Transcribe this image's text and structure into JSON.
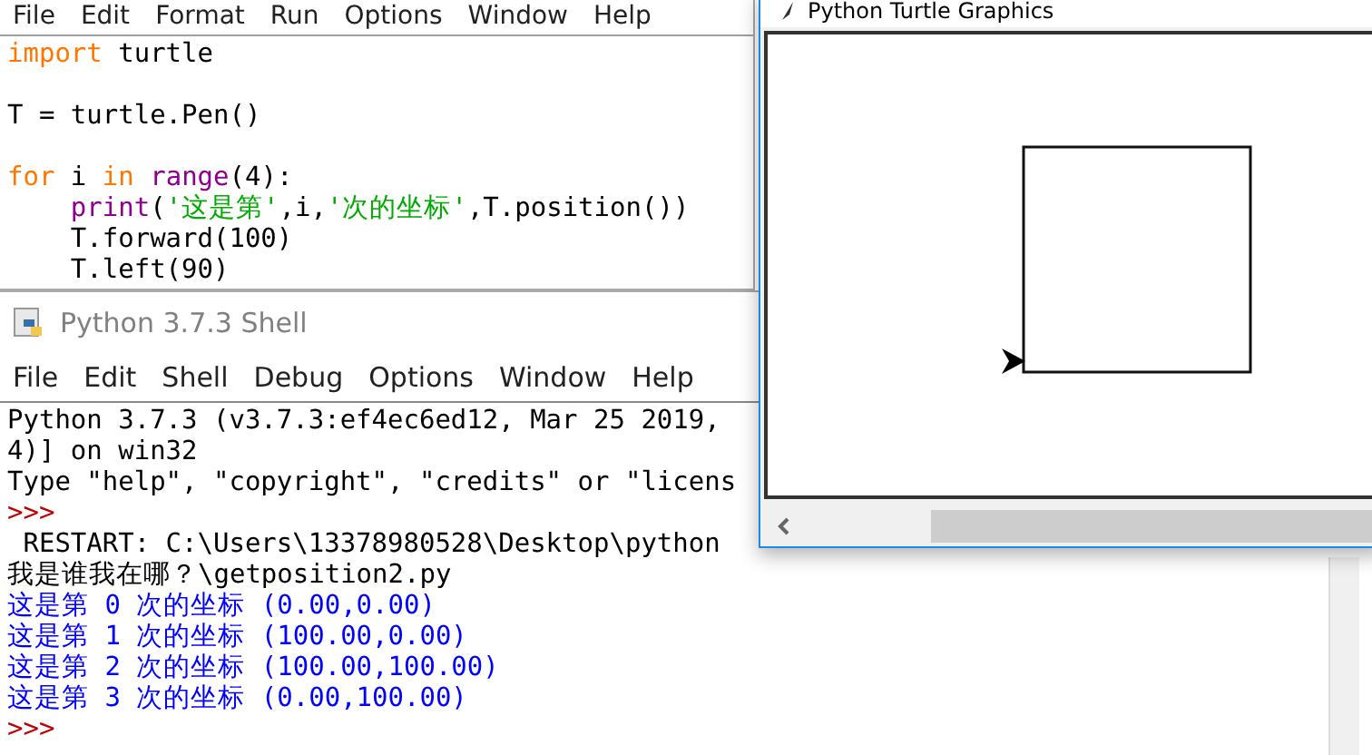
{
  "editor": {
    "menu": [
      "File",
      "Edit",
      "Format",
      "Run",
      "Options",
      "Window",
      "Help"
    ],
    "lines": [
      {
        "kind": "code",
        "tokens": [
          {
            "kind": "keyword",
            "text": "import"
          },
          {
            "kind": "plain",
            "text": " turtle"
          }
        ]
      },
      {
        "kind": "blank"
      },
      {
        "kind": "code",
        "tokens": [
          {
            "kind": "plain",
            "text": "T = turtle.Pen()"
          }
        ]
      },
      {
        "kind": "blank"
      },
      {
        "kind": "code",
        "tokens": [
          {
            "kind": "keyword",
            "text": "for"
          },
          {
            "kind": "plain",
            "text": " i "
          },
          {
            "kind": "keyword",
            "text": "in"
          },
          {
            "kind": "builtin",
            "text": " range"
          },
          {
            "kind": "plain",
            "text": "(4):"
          }
        ]
      },
      {
        "kind": "code",
        "tokens": [
          {
            "kind": "builtin",
            "text": "    print"
          },
          {
            "kind": "plain",
            "text": "("
          },
          {
            "kind": "string",
            "text": "'这是第'"
          },
          {
            "kind": "plain",
            "text": ",i,"
          },
          {
            "kind": "string",
            "text": "'次的坐标'"
          },
          {
            "kind": "plain",
            "text": ",T.position())"
          }
        ]
      },
      {
        "kind": "code",
        "tokens": [
          {
            "kind": "plain",
            "text": "    T.forward(100)"
          }
        ]
      },
      {
        "kind": "code",
        "tokens": [
          {
            "kind": "plain",
            "text": "    T.left(90)"
          }
        ]
      }
    ]
  },
  "shell": {
    "title": "Python 3.7.3 Shell",
    "menu": [
      "File",
      "Edit",
      "Shell",
      "Debug",
      "Options",
      "Window",
      "Help"
    ],
    "lines": [
      {
        "kind": "text",
        "text": "Python 3.7.3 (v3.7.3:ef4ec6ed12, Mar 25 2019,"
      },
      {
        "kind": "text",
        "text": "4)] on win32"
      },
      {
        "kind": "text",
        "text": "Type \"help\", \"copyright\", \"credits\" or \"licens"
      },
      {
        "kind": "prompt",
        "text": ">>>"
      },
      {
        "kind": "text",
        "text": " RESTART: C:\\Users\\13378980528\\Desktop\\python"
      },
      {
        "kind": "text",
        "text": "我是谁我在哪？\\getposition2.py"
      },
      {
        "kind": "output",
        "text": "这是第 0 次的坐标 (0.00,0.00)"
      },
      {
        "kind": "output",
        "text": "这是第 1 次的坐标 (100.00,0.00)"
      },
      {
        "kind": "output",
        "text": "这是第 2 次的坐标 (100.00,100.00)"
      },
      {
        "kind": "output",
        "text": "这是第 3 次的坐标 (0.00,100.00)"
      },
      {
        "kind": "prompt",
        "text": ">>>"
      }
    ]
  },
  "turtle": {
    "title": "Python Turtle Graphics"
  }
}
